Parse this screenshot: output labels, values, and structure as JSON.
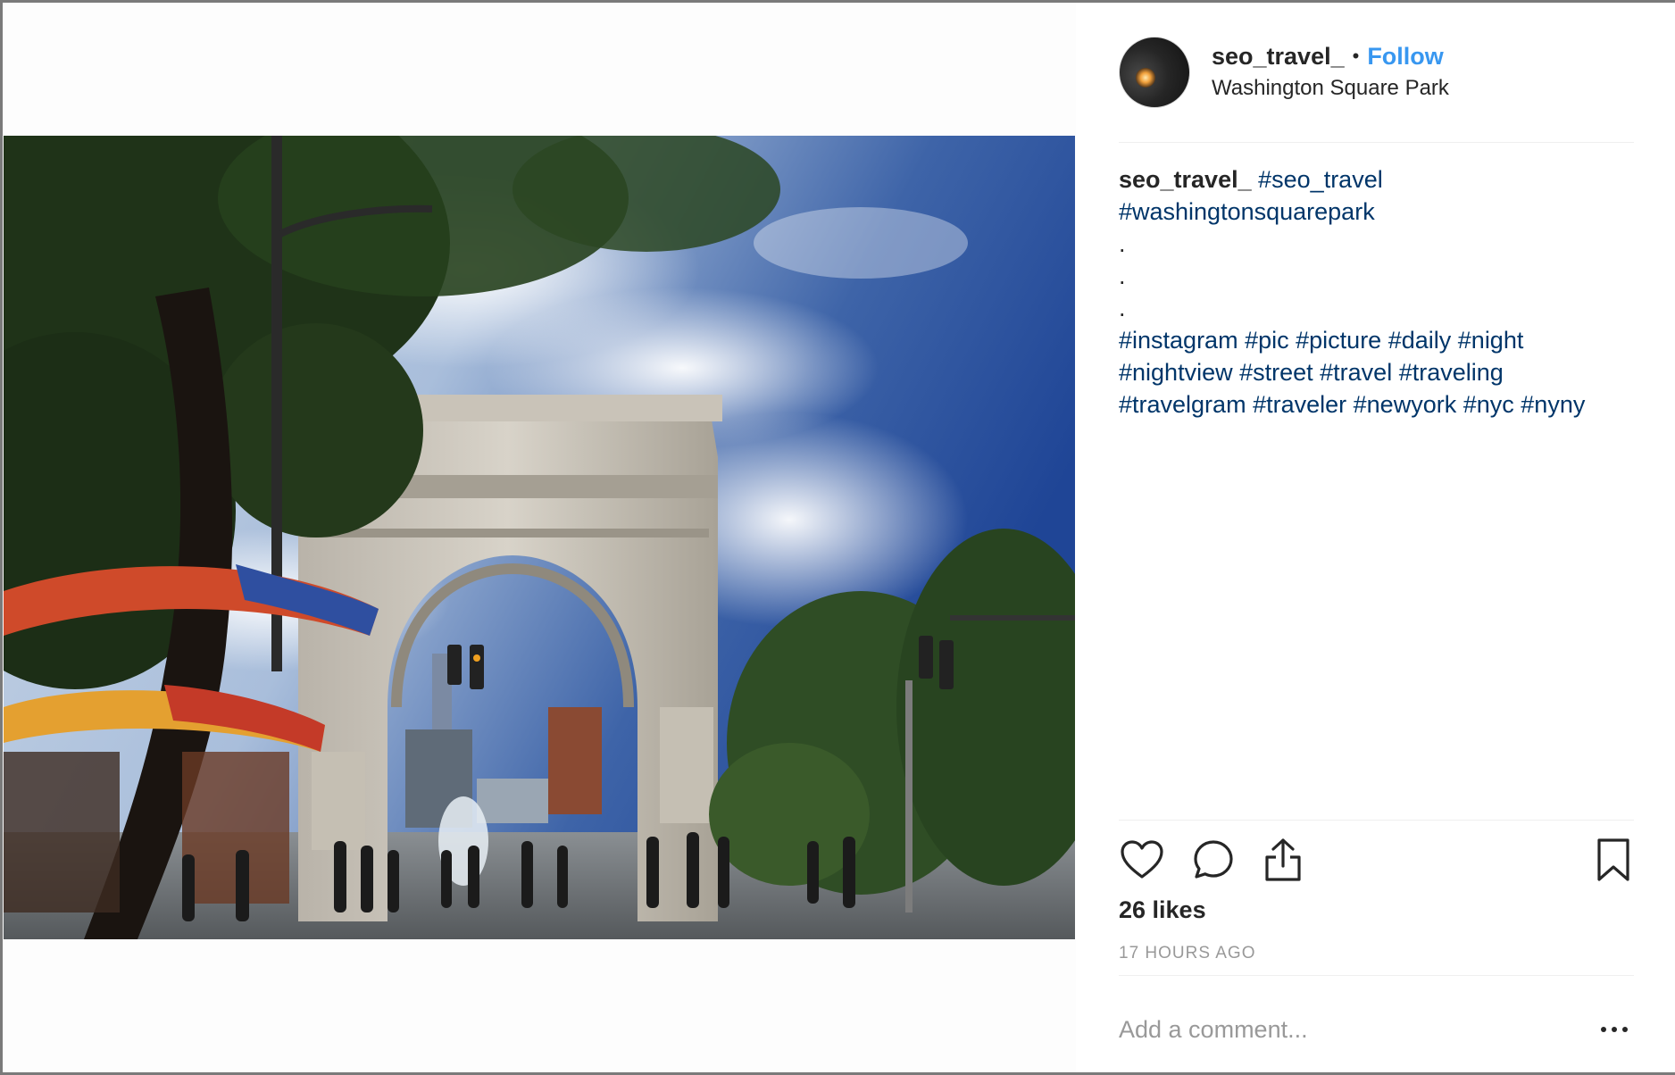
{
  "post": {
    "username": "seo_travel_",
    "separator": "•",
    "follow_label": "Follow",
    "location": "Washington Square Park",
    "photo_alt": "Washington Square Arch"
  },
  "caption": {
    "username": "seo_travel_",
    "lines": [
      [
        "#seo_travel"
      ],
      [
        "#washingtonsquarepark"
      ],
      [
        "."
      ],
      [
        "."
      ],
      [
        "."
      ],
      [
        "#instagram",
        "#pic",
        "#picture",
        "#daily",
        "#night"
      ],
      [
        "#nightview",
        "#street",
        "#travel",
        "#traveling"
      ],
      [
        "#travelgram",
        "#traveler",
        "#newyork",
        "#nyc",
        "#nyny"
      ]
    ]
  },
  "stats": {
    "likes": "26 likes",
    "timestamp": "17 HOURS AGO"
  },
  "comment": {
    "placeholder": "Add a comment..."
  },
  "icons": {
    "like": "heart-icon",
    "comment": "comment-icon",
    "share": "share-icon",
    "save": "bookmark-icon",
    "more": "more-options-icon"
  },
  "colors": {
    "follow": "#3897f0",
    "hashtag": "#003569",
    "text": "#262626",
    "muted": "#999999",
    "divider": "#efefef"
  }
}
